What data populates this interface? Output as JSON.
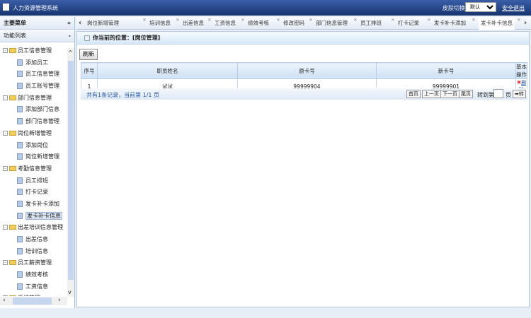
{
  "header": {
    "title": "人力资源管理系统",
    "skin_label": "皮肤切换：",
    "skin_value": "默认",
    "logout": "安全退出"
  },
  "sidebar": {
    "main_menu": "主要菜单",
    "collapse": "«",
    "func_list": "功能列表",
    "func_toggle": "-",
    "items": [
      {
        "type": "group",
        "label": "员工信息管理"
      },
      {
        "type": "item",
        "label": "添加员工"
      },
      {
        "type": "item",
        "label": "员工信息管理"
      },
      {
        "type": "item",
        "label": "员工账号管理"
      },
      {
        "type": "group",
        "label": "部门信息管理"
      },
      {
        "type": "item",
        "label": "添加部门信息"
      },
      {
        "type": "item",
        "label": "部门信息管理"
      },
      {
        "type": "group",
        "label": "岗位新增管理"
      },
      {
        "type": "item",
        "label": "添加岗位"
      },
      {
        "type": "item",
        "label": "岗位新增管理"
      },
      {
        "type": "group",
        "label": "考勤信息管理"
      },
      {
        "type": "item",
        "label": "员工排班"
      },
      {
        "type": "item",
        "label": "打卡记录"
      },
      {
        "type": "item",
        "label": "发卡补卡添加"
      },
      {
        "type": "item",
        "label": "发卡补卡信息",
        "selected": true
      },
      {
        "type": "group",
        "label": "出差培训信息管理"
      },
      {
        "type": "item",
        "label": "出差信息"
      },
      {
        "type": "item",
        "label": "培训信息"
      },
      {
        "type": "group",
        "label": "员工薪资管理"
      },
      {
        "type": "item",
        "label": "绩效考核"
      },
      {
        "type": "item",
        "label": "工资信息"
      },
      {
        "type": "group",
        "label": "系统管理"
      }
    ]
  },
  "tabs": [
    "岗位新增管理",
    "培训信息",
    "出差信息",
    "工资信息",
    "绩效考核",
    "修改密码",
    "部门信息管理",
    "员工排班",
    "打卡记录",
    "发卡补卡添加",
    "发卡补卡信息"
  ],
  "active_tab": "发卡补卡信息",
  "main": {
    "breadcrumb": "你当前的位置：[岗位管理]",
    "refresh": "刷新",
    "columns": [
      "序号",
      "职员姓名",
      "原卡号",
      "新卡号",
      "基本操作"
    ],
    "rows": [
      {
        "no": "1",
        "name": "试试",
        "old_card": "99999904",
        "new_card": "99999901",
        "action": "删除"
      }
    ],
    "pager": {
      "info": "共有1条记录，当前第 1/1 页",
      "first": "首页",
      "prev": "上一页",
      "next": "下一页",
      "last": "尾页",
      "goto_label": "转到第",
      "page_unit": "页",
      "go": "➡转"
    }
  }
}
